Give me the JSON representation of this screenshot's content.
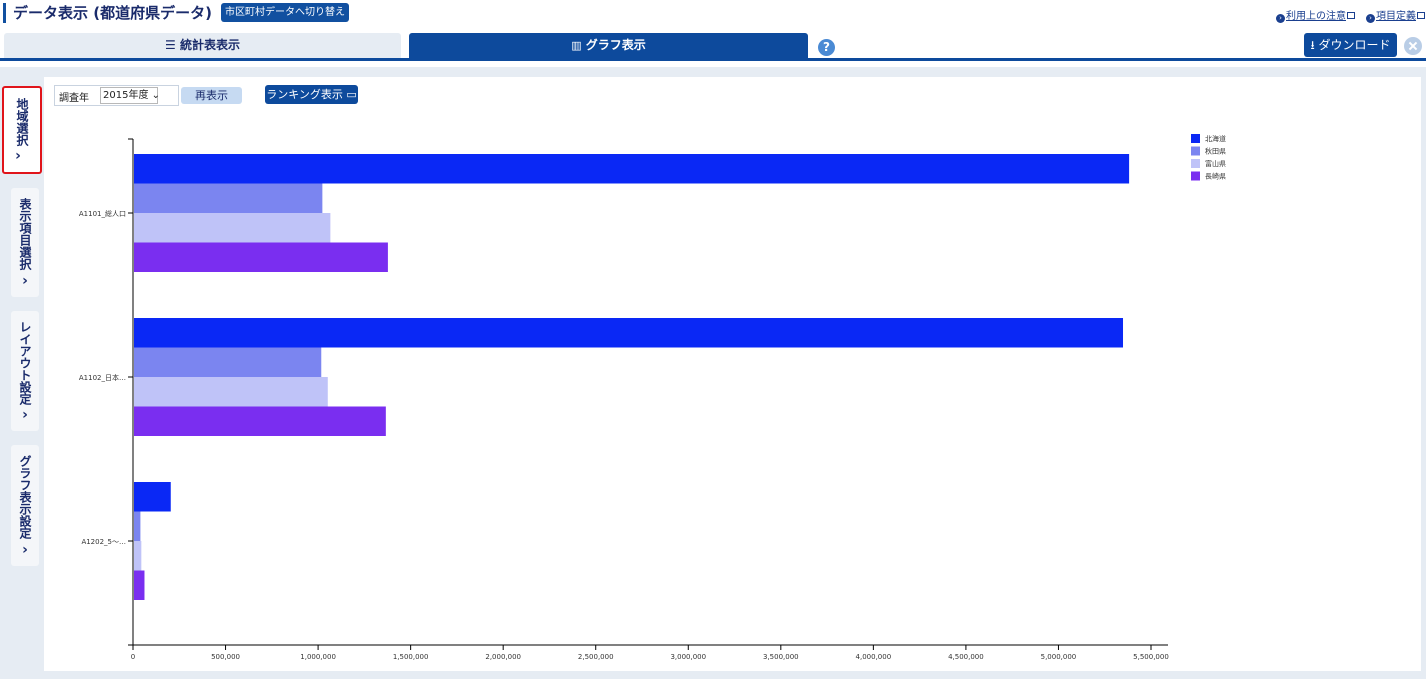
{
  "header": {
    "title": "データ表示 (都道府県データ)",
    "switch_label": "市区町村データへ切り替え",
    "notice_link": "利用上の注意",
    "definition_link": "項目定義"
  },
  "tabs": {
    "table_label": "統計表表示",
    "graph_label": "グラフ表示"
  },
  "toolbar": {
    "help": "?",
    "download_label": "ダウンロード"
  },
  "sidebar": {
    "region": "地域選択",
    "items": "表示項目選択",
    "layout": "レイアウト設定",
    "graph": "グラフ表示設定"
  },
  "controls": {
    "year_label": "調査年",
    "year_value": "2015年度",
    "redisplay": "再表示",
    "ranking": "ランキング表示"
  },
  "chart_data": {
    "type": "bar",
    "orientation": "horizontal",
    "categories": [
      "A1101_総人口",
      "A1102_日本…",
      "A1202_5～…"
    ],
    "series": [
      {
        "name": "北海道",
        "color": "#0a28f5",
        "values": [
          5381733,
          5348768,
          204000
        ]
      },
      {
        "name": "秋田県",
        "color": "#7b85f0",
        "values": [
          1023119,
          1017149,
          40000
        ]
      },
      {
        "name": "富山県",
        "color": "#bfc3f8",
        "values": [
          1066328,
          1052353,
          45000
        ]
      },
      {
        "name": "長崎県",
        "color": "#7a2ef0",
        "values": [
          1377187,
          1366000,
          62000
        ]
      }
    ],
    "xlim": [
      0,
      5500000
    ],
    "xticks": [
      "0",
      "500,000",
      "1,000,000",
      "1,500,000",
      "2,000,000",
      "2,500,000",
      "3,000,000",
      "3,500,000",
      "4,000,000",
      "4,500,000",
      "5,000,000",
      "5,500,000"
    ],
    "legend": "top-right"
  }
}
